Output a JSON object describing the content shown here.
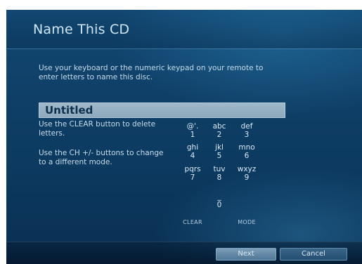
{
  "page": {
    "title": "Name This CD",
    "instructions": "Use your keyboard or the numeric keypad on your remote to enter letters to name this disc.",
    "name_value": "Untitled",
    "help_clear": "Use the CLEAR button to delete letters.",
    "help_mode": "Use the CH +/- buttons to change to a different mode."
  },
  "keypad": {
    "keys": [
      {
        "letters": "@'.",
        "digit": "1"
      },
      {
        "letters": "abc",
        "digit": "2"
      },
      {
        "letters": "def",
        "digit": "3"
      },
      {
        "letters": "ghi",
        "digit": "4"
      },
      {
        "letters": "jkl",
        "digit": "5"
      },
      {
        "letters": "mno",
        "digit": "6"
      },
      {
        "letters": "pqrs",
        "digit": "7"
      },
      {
        "letters": "tuv",
        "digit": "8"
      },
      {
        "letters": "wxyz",
        "digit": "9"
      },
      {
        "letters": "_",
        "digit": "0"
      }
    ],
    "clear_label": "CLEAR",
    "mode_label": "MODE"
  },
  "buttons": {
    "next_label": "Next",
    "cancel_label": "Cancel"
  }
}
